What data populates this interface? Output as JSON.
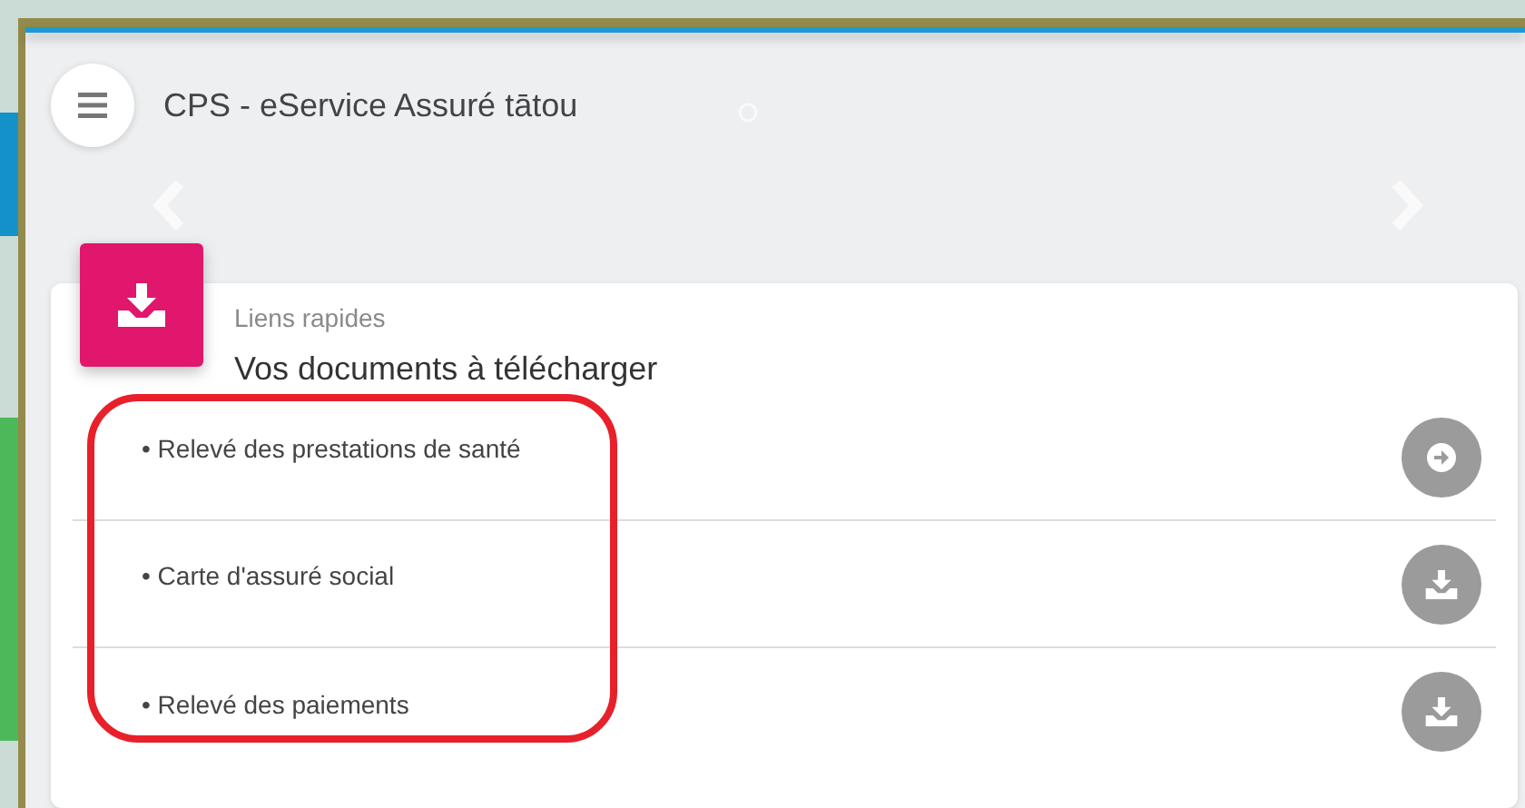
{
  "app_bar": {
    "title": "CPS - eService Assuré tātou"
  },
  "card": {
    "subtitle": "Liens rapides",
    "title": "Vos documents à télécharger",
    "items": [
      {
        "marker": "•",
        "label": "Relevé des prestations de santé",
        "kind": "open"
      },
      {
        "marker": "•",
        "label": "Carte d'assuré social",
        "kind": "download"
      },
      {
        "marker": "•",
        "label": "Relevé des paiements",
        "kind": "download"
      }
    ]
  },
  "annotation": {
    "kind": "outline"
  }
}
